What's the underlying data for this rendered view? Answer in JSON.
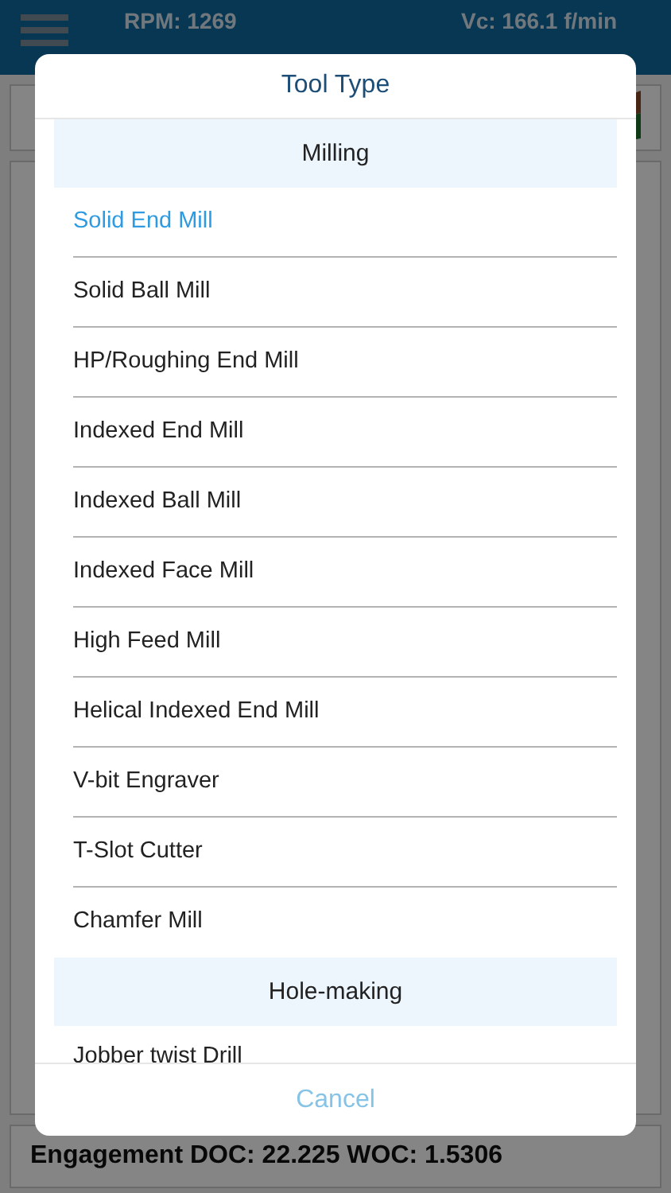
{
  "header": {
    "rpm": "RPM: 1269",
    "vc": "Vc: 166.1 f/min"
  },
  "engagement": "Engagement DOC: 22.225 WOC: 1.5306",
  "dialog": {
    "title": "Tool Type",
    "cancel": "Cancel",
    "items": [
      {
        "kind": "section",
        "label": "Milling"
      },
      {
        "kind": "item",
        "label": "Solid End Mill",
        "selected": true
      },
      {
        "kind": "item",
        "label": "Solid Ball Mill",
        "selected": false
      },
      {
        "kind": "item",
        "label": "HP/Roughing End Mill",
        "selected": false
      },
      {
        "kind": "item",
        "label": "Indexed End Mill",
        "selected": false
      },
      {
        "kind": "item",
        "label": "Indexed Ball Mill",
        "selected": false
      },
      {
        "kind": "item",
        "label": "Indexed Face Mill",
        "selected": false
      },
      {
        "kind": "item",
        "label": "High Feed Mill",
        "selected": false
      },
      {
        "kind": "item",
        "label": "Helical Indexed End Mill",
        "selected": false
      },
      {
        "kind": "item",
        "label": "V-bit Engraver",
        "selected": false
      },
      {
        "kind": "item",
        "label": "T-Slot Cutter",
        "selected": false
      },
      {
        "kind": "item",
        "label": "Chamfer Mill",
        "selected": false
      },
      {
        "kind": "section",
        "label": "Hole-making"
      },
      {
        "kind": "item",
        "label": "Jobber twist Drill",
        "selected": false
      }
    ]
  }
}
